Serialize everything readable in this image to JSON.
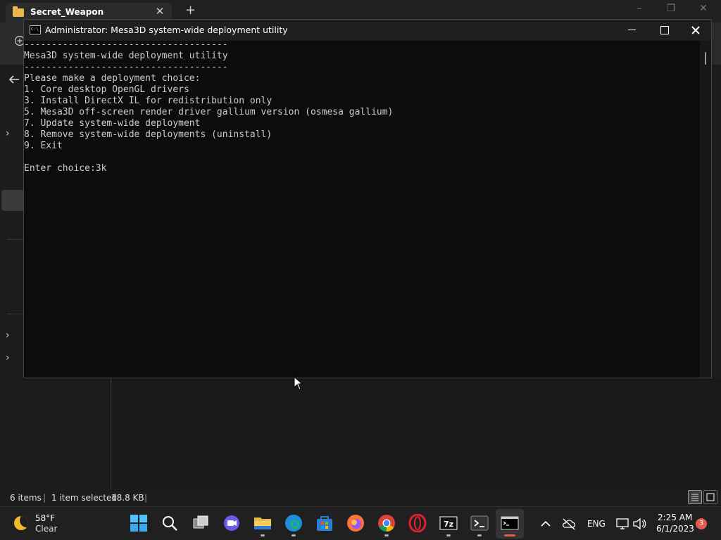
{
  "explorer": {
    "tab_title": "Secret_Weapon",
    "tab_close": "✕",
    "new_tab": "+",
    "status": {
      "items": "6 items",
      "separator": "|",
      "selected": "1 item selected",
      "size": "18.8 KB",
      "separator2": "|"
    }
  },
  "console": {
    "title": "Administrator:  Mesa3D system-wide deployment utility",
    "lines": [
      "-------------------------------------",
      "Mesa3D system-wide deployment utility",
      "-------------------------------------",
      "Please make a deployment choice:",
      "1. Core desktop OpenGL drivers",
      "3. Install DirectX IL for redistribution only",
      "5. Mesa3D off-screen render driver gallium version (osmesa gallium)",
      "7. Update system-wide deployment",
      "8. Remove system-wide deployments (uninstall)",
      "9. Exit",
      "",
      "Enter choice:3k"
    ]
  },
  "taskbar": {
    "weather": {
      "temperature": "58°F",
      "condition": "Clear"
    },
    "apps": [
      "start",
      "search",
      "task-view",
      "chat",
      "file-explorer",
      "edge",
      "store",
      "firefox",
      "chrome",
      "opera",
      "7zip",
      "terminal",
      "command-prompt"
    ],
    "tray": {
      "language": "ENG",
      "time": "2:25 AM",
      "date": "6/1/2023",
      "notification_count": "3"
    }
  },
  "colors": {
    "console_bg": "#0c0c0c",
    "console_text": "#cccccc",
    "taskbar_bg": "#202020",
    "badge": "#e05a4e"
  }
}
